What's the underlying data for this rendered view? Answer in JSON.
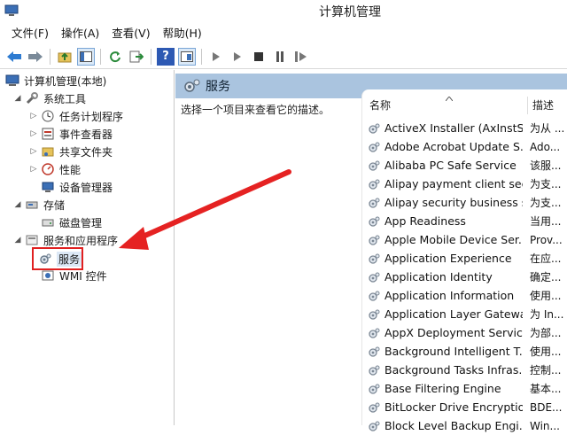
{
  "window": {
    "title": "计算机管理"
  },
  "menu": [
    "文件(F)",
    "操作(A)",
    "查看(V)",
    "帮助(H)"
  ],
  "tree": {
    "root": "计算机管理(本地)",
    "system_tools": "系统工具",
    "task_scheduler": "任务计划程序",
    "event_viewer": "事件查看器",
    "shared_folders": "共享文件夹",
    "performance": "性能",
    "device_manager": "设备管理器",
    "storage": "存储",
    "disk_management": "磁盘管理",
    "services_apps": "服务和应用程序",
    "services": "服务",
    "wmi": "WMI 控件"
  },
  "services_pane": {
    "header": "服务",
    "description_prompt": "选择一个项目来查看它的描述。",
    "col_name": "名称",
    "col_desc": "描述",
    "rows": [
      {
        "name": "ActiveX Installer (AxInstSV)",
        "desc": "为从 ..."
      },
      {
        "name": "Adobe Acrobat Update S...",
        "desc": "Ado..."
      },
      {
        "name": "Alibaba PC Safe Service",
        "desc": "该服..."
      },
      {
        "name": "Alipay payment client sec...",
        "desc": "为支..."
      },
      {
        "name": "Alipay security business s...",
        "desc": "为支..."
      },
      {
        "name": "App Readiness",
        "desc": "当用..."
      },
      {
        "name": "Apple Mobile Device Ser...",
        "desc": "Prov..."
      },
      {
        "name": "Application Experience",
        "desc": "在应..."
      },
      {
        "name": "Application Identity",
        "desc": "确定..."
      },
      {
        "name": "Application Information",
        "desc": "使用..."
      },
      {
        "name": "Application Layer Gatewa...",
        "desc": "为 In..."
      },
      {
        "name": "AppX Deployment Servic...",
        "desc": "为部..."
      },
      {
        "name": "Background Intelligent T...",
        "desc": "使用..."
      },
      {
        "name": "Background Tasks Infras...",
        "desc": "控制..."
      },
      {
        "name": "Base Filtering Engine",
        "desc": "基本..."
      },
      {
        "name": "BitLocker Drive Encryptio...",
        "desc": "BDE..."
      },
      {
        "name": "Block Level Backup Engi...",
        "desc": "Win..."
      }
    ]
  },
  "colors": {
    "header_bg": "#aac4df",
    "highlight": "#e02020"
  }
}
